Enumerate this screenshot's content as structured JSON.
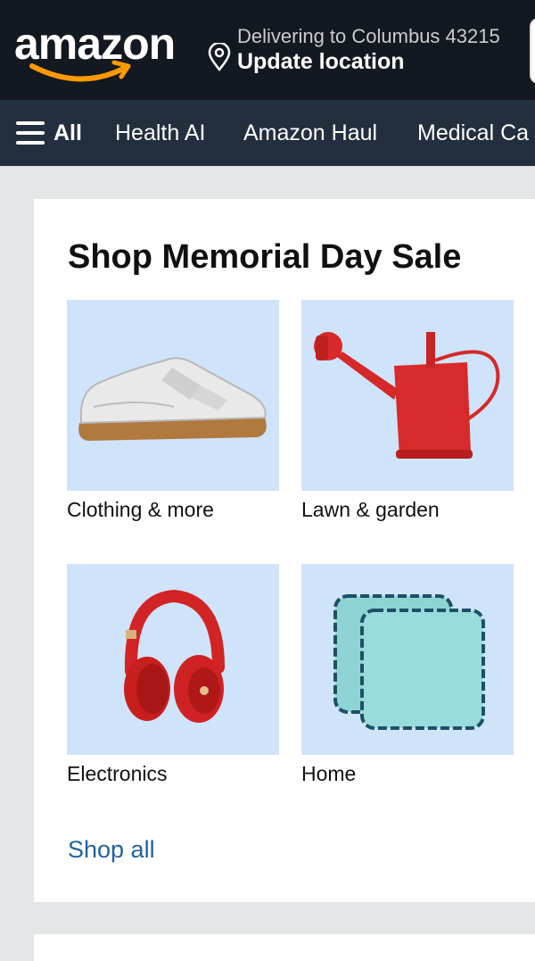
{
  "header": {
    "logo_text": "amazon",
    "delivery_line": "Delivering to Columbus 43215",
    "update_location": "Update location"
  },
  "nav": {
    "all_label": "All",
    "items": [
      "Health AI",
      "Amazon Haul",
      "Medical Ca"
    ]
  },
  "card": {
    "title": "Shop Memorial Day Sale",
    "tiles": [
      {
        "label": "Clothing & more",
        "icon": "sneaker-icon"
      },
      {
        "label": "Lawn & garden",
        "icon": "watering-can-icon"
      },
      {
        "label": "Electronics",
        "icon": "headphones-icon"
      },
      {
        "label": "Home",
        "icon": "pillows-icon"
      }
    ],
    "shop_all": "Shop all"
  },
  "colors": {
    "topbar": "#131921",
    "navbar": "#232f3e",
    "tile_bg": "#cfe3fb",
    "link": "#2162a1",
    "logo_smile": "#ff9900"
  }
}
